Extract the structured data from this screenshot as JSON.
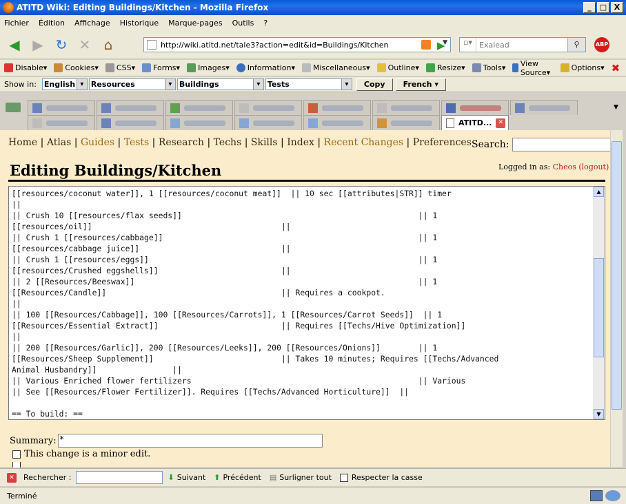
{
  "window": {
    "title": "ATITD Wiki: Editing Buildings/Kitchen - Mozilla Firefox",
    "minimize": "_",
    "maximize": "□",
    "close": "X"
  },
  "menu": [
    "Fichier",
    "Édition",
    "Affichage",
    "Historique",
    "Marque-pages",
    "Outils",
    "?"
  ],
  "navbar": {
    "url": "http://wiki.atitd.net/tale3?action=edit&id=Buildings/Kitchen",
    "search_placeholder": "Exalead",
    "abp": "ABP"
  },
  "devbar": [
    "Disable▾",
    "Cookies▾",
    "CSS▾",
    "Forms▾",
    "Images▾",
    "Information▾",
    "Miscellaneous▾",
    "Outline▾",
    "Resize▾",
    "Tools▾",
    "View Source▾",
    "Options▾"
  ],
  "showbar": {
    "label": "Show in:",
    "language": "English",
    "cat1": "Resources",
    "cat2": "Buildings",
    "cat3": "Tests",
    "copy": "Copy",
    "french": "French ▾"
  },
  "active_tab": "ATITD...",
  "site_nav": [
    {
      "label": "Home",
      "muted": false
    },
    {
      "label": "Atlas",
      "muted": false
    },
    {
      "label": "Guides",
      "muted": true
    },
    {
      "label": "Tests",
      "muted": true
    },
    {
      "label": "Research",
      "muted": false
    },
    {
      "label": "Techs",
      "muted": false
    },
    {
      "label": "Skills",
      "muted": false
    },
    {
      "label": "Index",
      "muted": false
    },
    {
      "label": "Recent Changes",
      "muted": true
    },
    {
      "label": "Preferences",
      "muted": false
    }
  ],
  "site_search_label": "Search:",
  "page_title": "Editing Buildings/Kitchen",
  "login": {
    "prefix": "Logged in as:",
    "user": "Cheos",
    "logout": "(logout)"
  },
  "editor_text": "[[resources/coconut water]], 1 [[resources/coconut meat]]  || 10 sec [[attributes|STR]] timer\n||\n|| Crush 10 [[resources/flax seeds]]                                                  || 1\n[[resources/oil]]                                        ||\n|| Crush 1 [[resources/cabbage]]                                                      || 1\n[[resources/cabbage juice]]                              ||\n|| Crush 1 [[resources/eggs]]                                                         || 1\n[[resources/Crushed eggshells]]                          ||\n|| 2 [[Resources/Beeswax]]                                                            || 1\n[[Resources/Candle]]                                     || Requires a cookpot.\n||\n|| 100 [[Resources/Cabbage]], 100 [[Resources/Carrots]], 1 [[Resources/Carrot Seeds]]  || 1\n[[Resources/Essential Extract]]                          || Requires [[Techs/Hive Optimization]]\n||\n|| 200 [[Resources/Garlic]], 200 [[Resources/Leeks]], 200 [[Resources/Onions]]        || 1\n[[Resources/Sheep Supplement]]                           || Takes 10 minutes; Requires [[Techs/Advanced\nAnimal Husbandry]]                ||\n|| Various Enriched flower fertilizers                                                || Various\n|| See [[Resources/Flower Fertilizer]]. Requires [[Techs/Advanced Horticulture]]  ||\n\n== To build: ==",
  "summary": {
    "label": "Summary:",
    "value": "*"
  },
  "minor_edit": "This change is a minor edit.",
  "findbar": {
    "label": "Rechercher :",
    "next": "Suivant",
    "prev": "Précédent",
    "highlight": "Surligner tout",
    "match_case": "Respecter la casse"
  },
  "status": "Terminé"
}
